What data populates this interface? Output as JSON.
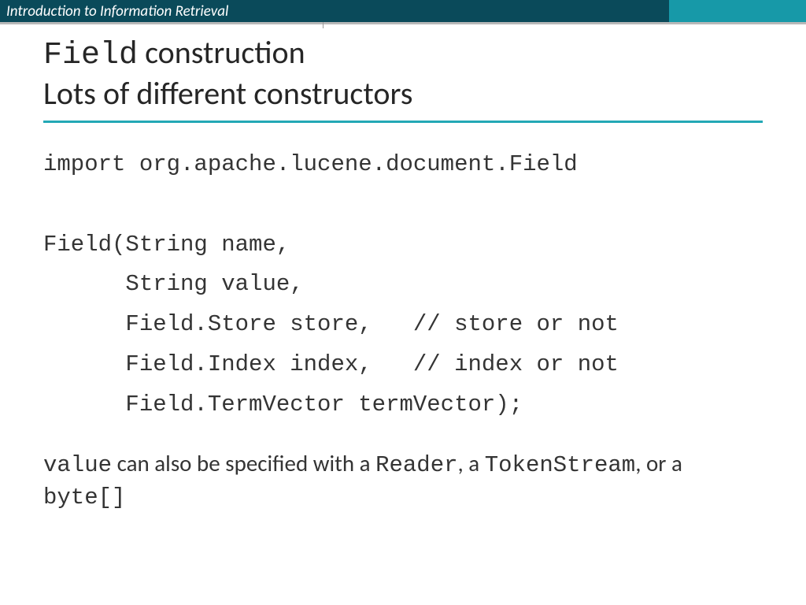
{
  "header": {
    "title": "Introduction to Information Retrieval"
  },
  "title": {
    "codeWord": "Field",
    "rest1": " construction",
    "line2": "Lots of different constructors"
  },
  "code": {
    "l1": "import org.apache.lucene.document.Field",
    "l2": "",
    "l3": "Field(String name,",
    "l4": "      String value,",
    "l5": "      Field.Store store,   // store or not",
    "l6": "      Field.Index index,   // index or not",
    "l7": "      Field.TermVector termVector);"
  },
  "note": {
    "p1": "value",
    "p2": " can also be specified with a ",
    "p3": "Reader",
    "p4": ", a ",
    "p5": "TokenStream",
    "p6": ", or a ",
    "p7": "byte[]"
  }
}
